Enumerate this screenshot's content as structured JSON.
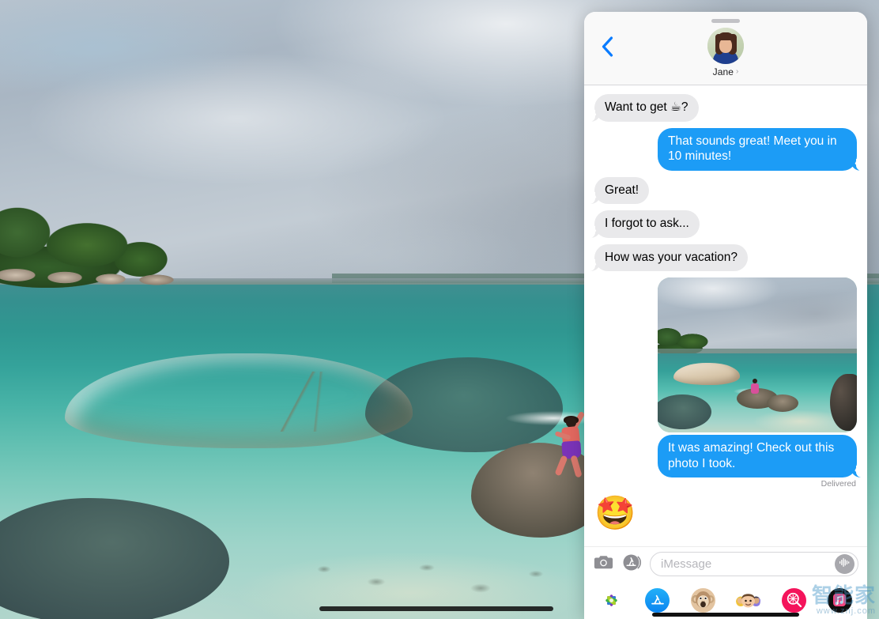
{
  "background": {
    "description": "Beach photo wallpaper with turquoise sea, pale boulder, island and a person standing on a rock",
    "home_indicator": "home-indicator"
  },
  "panel": {
    "nav": {
      "grabber": "drag-handle",
      "back_icon": "back-chevron-icon",
      "contact_name": "Jane",
      "contact_chevron": "›",
      "avatar_alt": "Jane profile photo"
    },
    "messages": [
      {
        "id": "m1",
        "side": "in",
        "type": "text",
        "text": "Want to get ☕?",
        "tail": true
      },
      {
        "id": "m2",
        "side": "out",
        "type": "text",
        "text": "That sounds great! Meet you in 10 minutes!",
        "tail": true
      },
      {
        "id": "m3",
        "side": "in",
        "type": "text",
        "text": "Great!",
        "tail": true
      },
      {
        "id": "m4",
        "side": "in",
        "type": "text",
        "text": "I forgot to ask...",
        "tail": true
      },
      {
        "id": "m5",
        "side": "in",
        "type": "text",
        "text": "How was your vacation?",
        "tail": true
      },
      {
        "id": "m6",
        "side": "out",
        "type": "photo",
        "caption": "It was amazing! Check out this photo I took.",
        "status": "Delivered"
      },
      {
        "id": "m7",
        "side": "in",
        "type": "emoji",
        "text": "🤩"
      }
    ],
    "input_bar": {
      "camera_icon": "camera-icon",
      "appstore_icon": "app-store-icon",
      "placeholder": "iMessage",
      "value": "",
      "audio_icon": "audio-waveform-icon"
    },
    "app_drawer": [
      {
        "id": "photos",
        "label": "Photos",
        "icon": "photos-icon",
        "color": "#ffffff"
      },
      {
        "id": "appstore",
        "label": "App Store",
        "icon": "app-store-icon",
        "color": "#0a84f0"
      },
      {
        "id": "animoji",
        "label": "Animoji",
        "icon": "monkey-animoji-icon",
        "color": "#e3c4a0"
      },
      {
        "id": "memoji",
        "label": "Memoji Stickers",
        "icon": "memoji-icon",
        "color": "#ffffff"
      },
      {
        "id": "digital",
        "label": "Digital Touch",
        "icon": "digital-touch-icon",
        "color": "#f4145b"
      },
      {
        "id": "music",
        "label": "Music",
        "icon": "music-icon",
        "color": "#0e0e0e"
      }
    ]
  },
  "watermark": {
    "main": "智能家",
    "sub": "www.znj.com"
  },
  "colors": {
    "bubble_in": "#e9e9eb",
    "bubble_out": "#1c9cf6",
    "accent_blue": "#0a7cff",
    "delivered_gray": "#8e8e93",
    "nav_bg": "#f9f9f9"
  }
}
